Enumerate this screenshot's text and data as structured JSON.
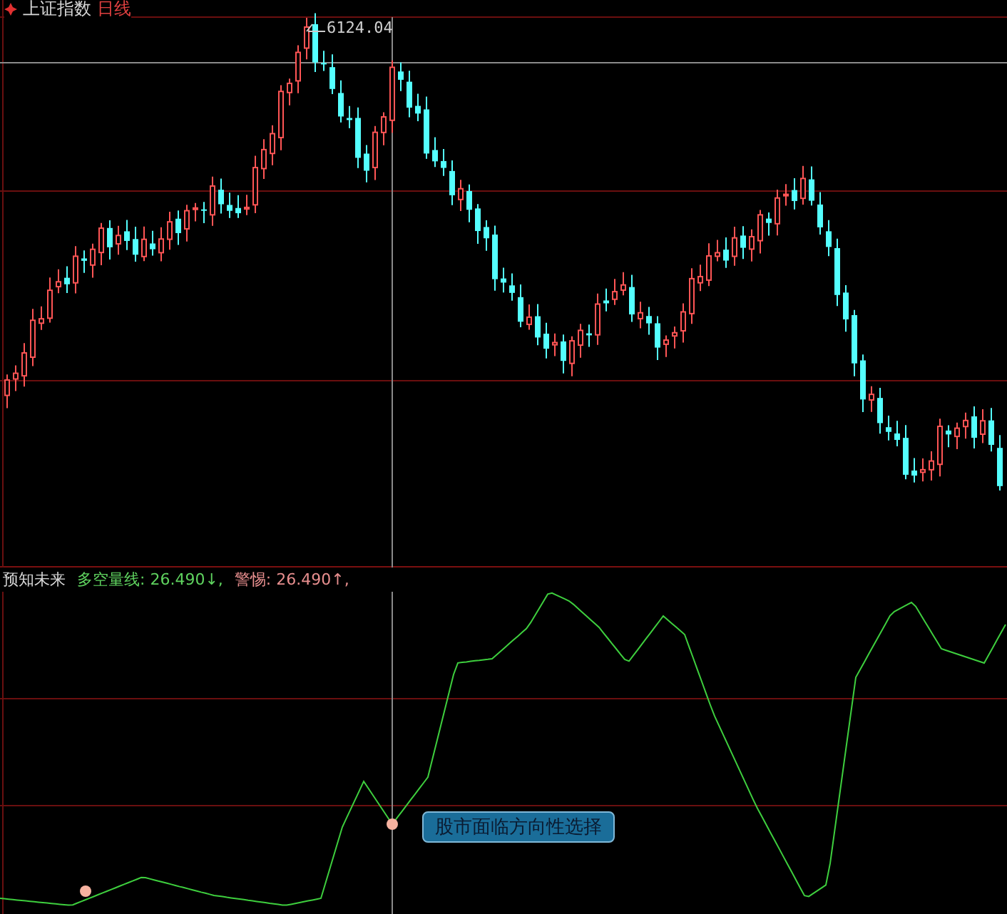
{
  "main_chart": {
    "title": "上证指数",
    "period": "日线",
    "high_label": "6124.04"
  },
  "indicator": {
    "name": "预知未来",
    "readings": [
      {
        "label": "多空量线:",
        "value": "26.490",
        "arrow": "↓",
        "separator": ",",
        "color": "#5fd35f"
      },
      {
        "label": "警惕:",
        "value": "26.490",
        "arrow": "↑",
        "separator": ",",
        "color": "#e88f8f"
      }
    ],
    "tooltip": "股市面临方向性选择"
  }
}
